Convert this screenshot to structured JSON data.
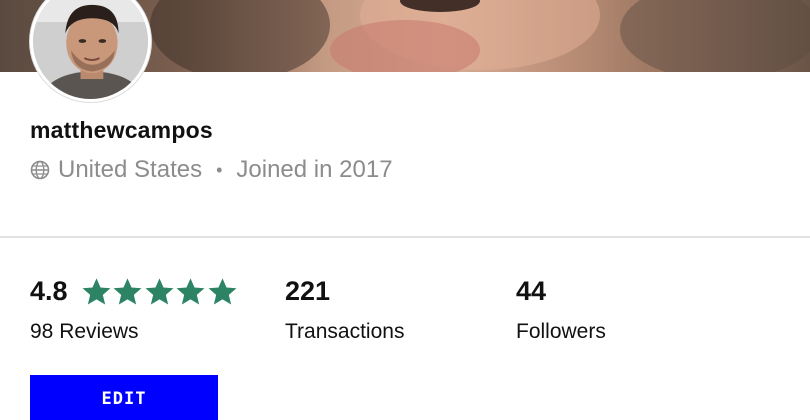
{
  "profile": {
    "username": "matthewcampos",
    "location": "United States",
    "separator": "•",
    "joined": "Joined in 2017"
  },
  "stats": {
    "rating": {
      "value": "4.8",
      "stars": 5,
      "label": "98 Reviews"
    },
    "transactions": {
      "value": "221",
      "label": "Transactions"
    },
    "followers": {
      "value": "44",
      "label": "Followers"
    }
  },
  "actions": {
    "edit_label": "EDIT"
  },
  "colors": {
    "star": "#2c8465",
    "button": "#0000ff",
    "muted_text": "#8c8c8c"
  },
  "icons": {
    "location": "globe-icon",
    "rating": "star-icon"
  }
}
